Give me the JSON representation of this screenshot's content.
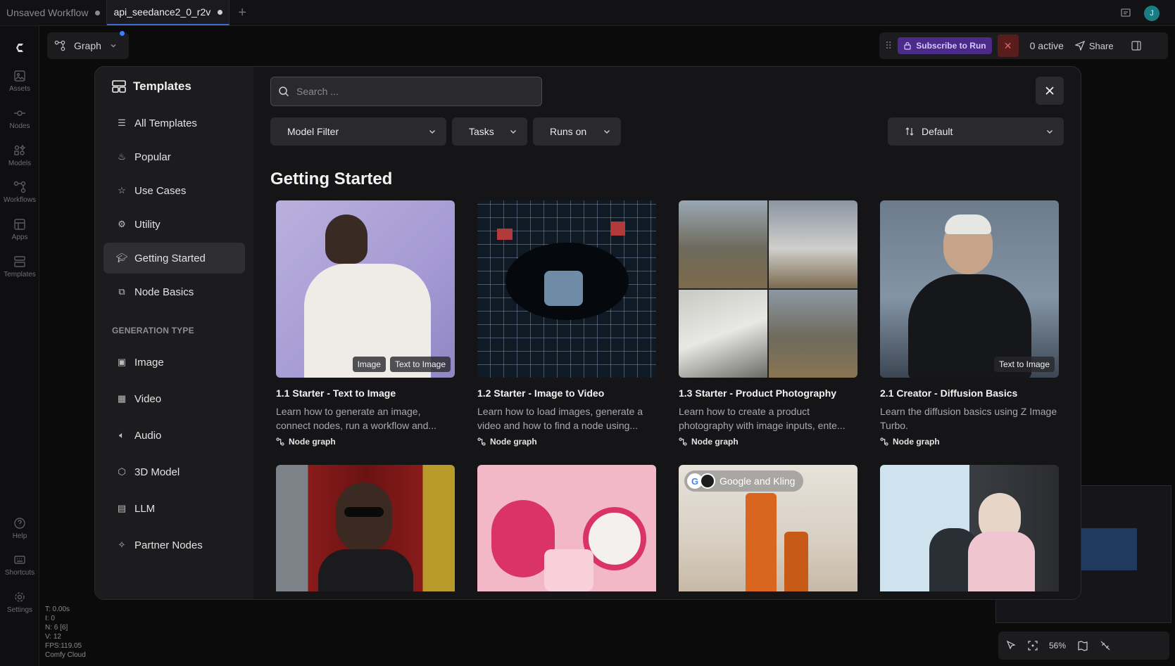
{
  "tabs": [
    {
      "label": "Unsaved Workflow",
      "active": false
    },
    {
      "label": "api_seedance2_0_r2v",
      "active": true
    }
  ],
  "avatar_initial": "J",
  "rail": [
    {
      "label": "Assets",
      "icon": "image-icon"
    },
    {
      "label": "Nodes",
      "icon": "nodes-icon"
    },
    {
      "label": "Models",
      "icon": "models-icon"
    },
    {
      "label": "Workflows",
      "icon": "workflow-icon"
    },
    {
      "label": "Apps",
      "icon": "apps-icon"
    },
    {
      "label": "Templates",
      "icon": "templates-icon"
    },
    {
      "label": "Help",
      "icon": "help-icon"
    },
    {
      "label": "Shortcuts",
      "icon": "keyboard-icon"
    },
    {
      "label": "Settings",
      "icon": "gear-icon"
    }
  ],
  "graph": {
    "label": "Graph"
  },
  "actions": {
    "subscribe": "Subscribe to Run",
    "active": "0 active",
    "share": "Share"
  },
  "modal": {
    "title": "Templates",
    "nav": [
      {
        "label": "All Templates",
        "icon": "list-icon"
      },
      {
        "label": "Popular",
        "icon": "flame-icon"
      },
      {
        "label": "Use Cases",
        "icon": "star-icon"
      },
      {
        "label": "Utility",
        "icon": "gear-icon"
      },
      {
        "label": "Getting Started",
        "icon": "graduation-cap-icon",
        "selected": true
      },
      {
        "label": "Node Basics",
        "icon": "blocks-icon"
      }
    ],
    "generation_heading": "GENERATION TYPE",
    "generation": [
      {
        "label": "Image",
        "icon": "image-icon"
      },
      {
        "label": "Video",
        "icon": "film-icon"
      },
      {
        "label": "Audio",
        "icon": "speaker-icon"
      },
      {
        "label": "3D Model",
        "icon": "cube-icon"
      },
      {
        "label": "LLM",
        "icon": "document-icon"
      },
      {
        "label": "Partner Nodes",
        "icon": "handshake-icon"
      }
    ],
    "search_placeholder": "Search ...",
    "filters": {
      "model": "Model Filter",
      "tasks": "Tasks",
      "runs_on": "Runs on",
      "sort": "Default"
    },
    "section": "Getting Started",
    "cards": [
      {
        "title": "1.1 Starter - Text to Image",
        "desc": "Learn how to generate an image, connect nodes, run a workflow and...",
        "kind": "Node graph",
        "badges": [
          "Image",
          "Text to Image"
        ]
      },
      {
        "title": "1.2 Starter - Image to Video",
        "desc": "Learn how to load images, generate a video and how to find a node using...",
        "kind": "Node graph",
        "badges": []
      },
      {
        "title": "1.3 Starter - Product Photography",
        "desc": "Learn how to create a product photography with image inputs, ente...",
        "kind": "Node graph",
        "badges": []
      },
      {
        "title": "2.1 Creator - Diffusion Basics",
        "desc": "Learn the diffusion basics using Z Image Turbo.",
        "kind": "Node graph",
        "badges": [
          "Text to Image"
        ]
      }
    ],
    "partner_pill": "Google and Kling"
  },
  "stats": [
    "T: 0.00s",
    "I: 0",
    "N: 6 [6]",
    "V: 12",
    "FPS:119.05",
    "Comfy Cloud"
  ],
  "zoom": "56%"
}
